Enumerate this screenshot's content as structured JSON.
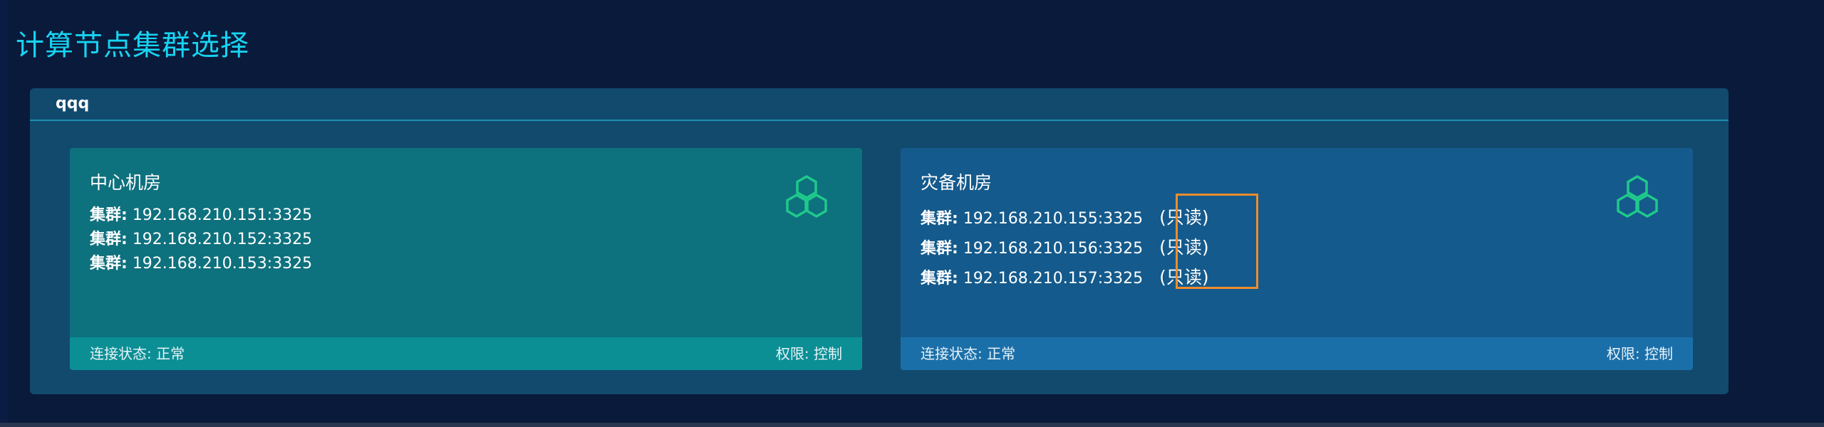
{
  "page": {
    "title": "计算节点集群选择"
  },
  "group": {
    "name": "qqq"
  },
  "cards": [
    {
      "title": "中心机房",
      "clusters": [
        {
          "label": "集群:",
          "address": "192.168.210.151:3325"
        },
        {
          "label": "集群:",
          "address": "192.168.210.152:3325"
        },
        {
          "label": "集群:",
          "address": "192.168.210.153:3325"
        }
      ],
      "status": "连接状态: 正常",
      "permission": "权限: 控制",
      "icon": "hexagon-cluster-icon"
    },
    {
      "title": "灾备机房",
      "clusters": [
        {
          "label": "集群:",
          "address": "192.168.210.155:3325",
          "tag": "(只读)"
        },
        {
          "label": "集群:",
          "address": "192.168.210.156:3325",
          "tag": "(只读)"
        },
        {
          "label": "集群:",
          "address": "192.168.210.157:3325",
          "tag": "(只读)"
        }
      ],
      "status": "连接状态: 正常",
      "permission": "权限: 控制",
      "icon": "hexagon-cluster-icon"
    }
  ],
  "colors": {
    "background": "#0a1a3a",
    "title": "#17d4f2",
    "panel": "#124a6e",
    "card_primary": "#0e717e",
    "card_primary_footer": "#0b8f95",
    "card_backup": "#145a8c",
    "card_backup_footer": "#1b6fa9",
    "icon_green": "#1fc98a",
    "highlight_orange": "#f08c2c"
  }
}
